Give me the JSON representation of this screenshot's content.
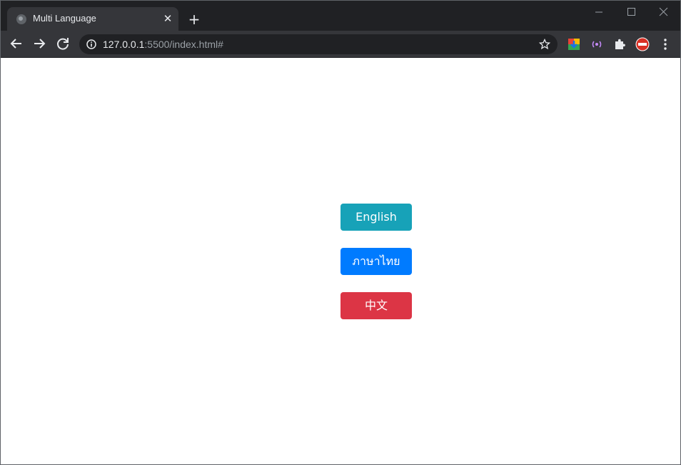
{
  "browser": {
    "tab": {
      "title": "Multi Language"
    },
    "address": {
      "host": "127.0.0.1",
      "rest": ":5500/index.html#"
    },
    "icons": {
      "back": "arrow-left-icon",
      "forward": "arrow-right-icon",
      "reload": "reload-icon",
      "info": "info-icon",
      "star": "star-icon",
      "extensions": "puzzle-icon",
      "menu": "kebab-menu-icon"
    }
  },
  "page": {
    "buttons": [
      {
        "label": "English",
        "color": "#17a2b8"
      },
      {
        "label": "ภาษาไทย",
        "color": "#007bff"
      },
      {
        "label": "中文",
        "color": "#dc3545"
      }
    ]
  }
}
